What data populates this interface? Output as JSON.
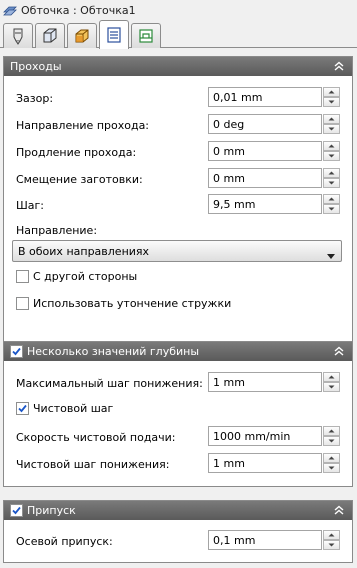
{
  "window": {
    "title": "Обточка : Обточка1",
    "icon": "toolpath-icon"
  },
  "tabs": [
    {
      "name": "tool-tab",
      "icon": "tool-icon"
    },
    {
      "name": "geometry-tab",
      "icon": "geometry-icon"
    },
    {
      "name": "heights-tab",
      "icon": "heights-icon"
    },
    {
      "name": "passes-tab",
      "icon": "passes-icon",
      "active": true
    },
    {
      "name": "linking-tab",
      "icon": "linking-icon"
    }
  ],
  "passes": {
    "title": "Проходы",
    "clearance_label": "Зазор:",
    "clearance_value": "0,01 mm",
    "direction_label": "Направление прохода:",
    "direction_value": "0 deg",
    "extension_label": "Продление прохода:",
    "extension_value": "0 mm",
    "stock_offset_label": "Смещение заготовки:",
    "stock_offset_value": "0 mm",
    "step_label": "Шаг:",
    "step_value": "9,5 mm",
    "direction_select_label": "Направление:",
    "direction_select_value": "В обоих направлениях",
    "other_side_label": "С другой стороны",
    "other_side_checked": false,
    "chip_thinning_label": "Использовать утончение стружки",
    "chip_thinning_checked": false
  },
  "multiple_depths": {
    "title": "Несколько значений глубины",
    "checked": true,
    "max_stepdown_label": "Максимальный шаг понижения:",
    "max_stepdown_value": "1 mm",
    "finishing_step_label": "Чистовой шаг",
    "finishing_step_checked": true,
    "finishing_feed_label": "Скорость чистовой подачи:",
    "finishing_feed_value": "1000 mm/min",
    "finishing_stepdown_label": "Чистовой шаг понижения:",
    "finishing_stepdown_value": "1 mm"
  },
  "stock_to_leave": {
    "title": "Припуск",
    "checked": true,
    "axial_label": "Осевой припуск:",
    "axial_value": "0,1 mm"
  },
  "colors": {
    "section_header": "#666666",
    "accent": "#1a56c8"
  }
}
